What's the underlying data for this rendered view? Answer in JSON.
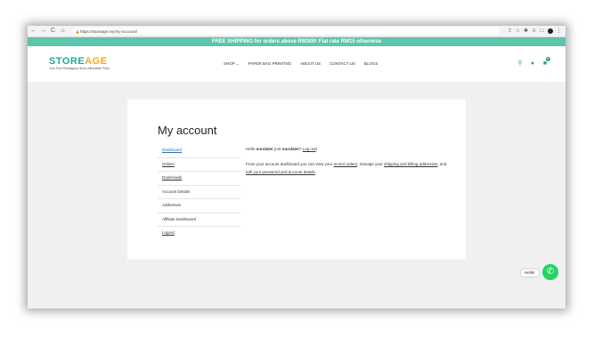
{
  "browser": {
    "nav_icons": [
      "back-icon",
      "forward-icon",
      "reload-icon",
      "home-icon"
    ],
    "back_glyph": "←",
    "forward_glyph": "→",
    "reload_glyph": "C",
    "home_glyph": "⌂",
    "url": "https://storeage.my/my-account/",
    "lock_glyph": "🔒",
    "right_icons": [
      "share-icon",
      "star-icon",
      "extension-icon",
      "media-icon",
      "sidebar-icon",
      "profile-icon",
      "menu-icon"
    ],
    "share_glyph": "⇪",
    "star_glyph": "☆",
    "extension_glyph": "✱",
    "media_glyph": "≡",
    "sidebar_glyph": "□",
    "menu_glyph": "⋮"
  },
  "promo": {
    "text": "FREE SHIPPING for orders above RM300! Flat rate RM15 otherwise",
    "color": "#5ec4ab"
  },
  "header": {
    "logo_part1": "STORE",
    "logo_part2": "AGE",
    "logo_tagline": "Your First Packaging Hit An Affordable Price",
    "logo_colors": [
      "#27a59a",
      "#f5a623"
    ],
    "nav": [
      {
        "label": "SHOP ⌄"
      },
      {
        "label": "PAPER BAG PRINTING"
      },
      {
        "label": "ABOUT US"
      },
      {
        "label": "CONTACT US"
      },
      {
        "label": "BLOGS"
      }
    ],
    "search_glyph": "⚲",
    "user_glyph": "●",
    "cart_glyph": "■",
    "cart_count": "0",
    "icon_color": "#2ca58d"
  },
  "account": {
    "title": "My account",
    "nav": [
      {
        "label": "Dashboard"
      },
      {
        "label": "Orders"
      },
      {
        "label": "Downloads"
      },
      {
        "label": "Account Details"
      },
      {
        "label": "Addresses"
      },
      {
        "label": "Affiliate Dashboard"
      },
      {
        "label": "Logout"
      }
    ],
    "hello_prefix": "Hello ",
    "username": "nurulatei",
    "not_prefix": " (not ",
    "not_username": "nurulatei",
    "not_mid": "? ",
    "logout_link": "Log out",
    "not_suffix": ")",
    "desc_1": "From your account dashboard you can view your ",
    "recent_orders_link": "recent orders",
    "desc_2": ", manage your ",
    "addresses_link": "shipping and billing addresses",
    "desc_3": ", and ",
    "edit_link": "edit your password and account details",
    "desc_4": "."
  },
  "chat": {
    "label": "Hello!",
    "glyph": "✆",
    "color": "#25d366"
  }
}
